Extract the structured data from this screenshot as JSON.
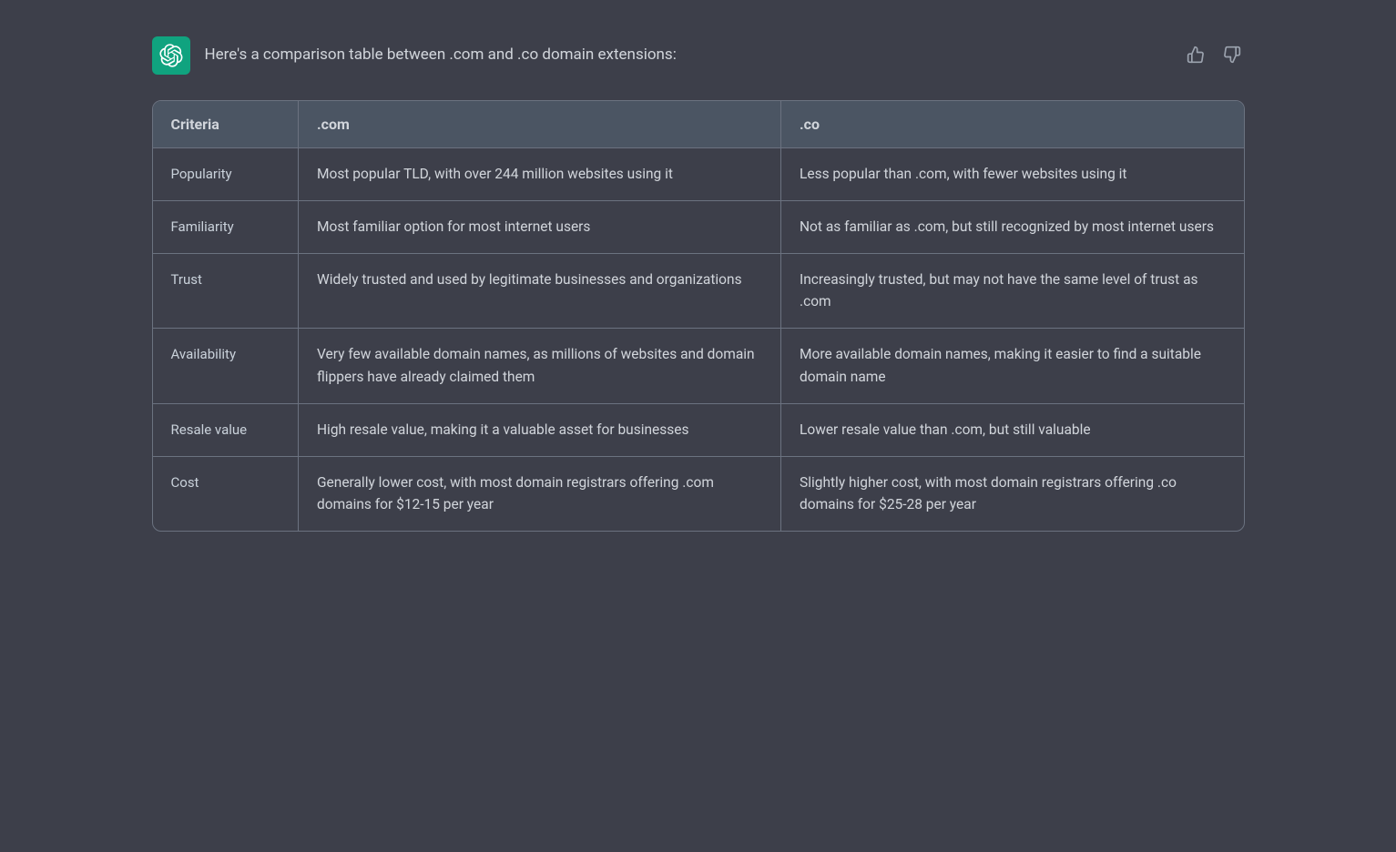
{
  "header": {
    "title": "Here's a comparison table between .com and .co domain extensions:",
    "logo_alt": "ChatGPT logo"
  },
  "feedback": {
    "thumbs_up_label": "Thumbs up",
    "thumbs_down_label": "Thumbs down"
  },
  "table": {
    "columns": [
      {
        "key": "criteria",
        "label": "Criteria"
      },
      {
        "key": "com",
        "label": ".com"
      },
      {
        "key": "co",
        "label": ".co"
      }
    ],
    "rows": [
      {
        "criteria": "Popularity",
        "com": "Most popular TLD, with over 244 million websites using it",
        "co": "Less popular than .com, with fewer websites using it"
      },
      {
        "criteria": "Familiarity",
        "com": "Most familiar option for most internet users",
        "co": "Not as familiar as .com, but still recognized by most internet users"
      },
      {
        "criteria": "Trust",
        "com": "Widely trusted and used by legitimate businesses and organizations",
        "co": "Increasingly trusted, but may not have the same level of trust as .com"
      },
      {
        "criteria": "Availability",
        "com": "Very few available domain names, as millions of websites and domain flippers have already claimed them",
        "co": "More available domain names, making it easier to find a suitable domain name"
      },
      {
        "criteria": "Resale value",
        "com": "High resale value, making it a valuable asset for businesses",
        "co": "Lower resale value than .com, but still valuable"
      },
      {
        "criteria": "Cost",
        "com": "Generally lower cost, with most domain registrars offering .com domains for $12-15 per year",
        "co": "Slightly higher cost, with most domain registrars offering .co domains for $25-28 per year"
      }
    ]
  }
}
